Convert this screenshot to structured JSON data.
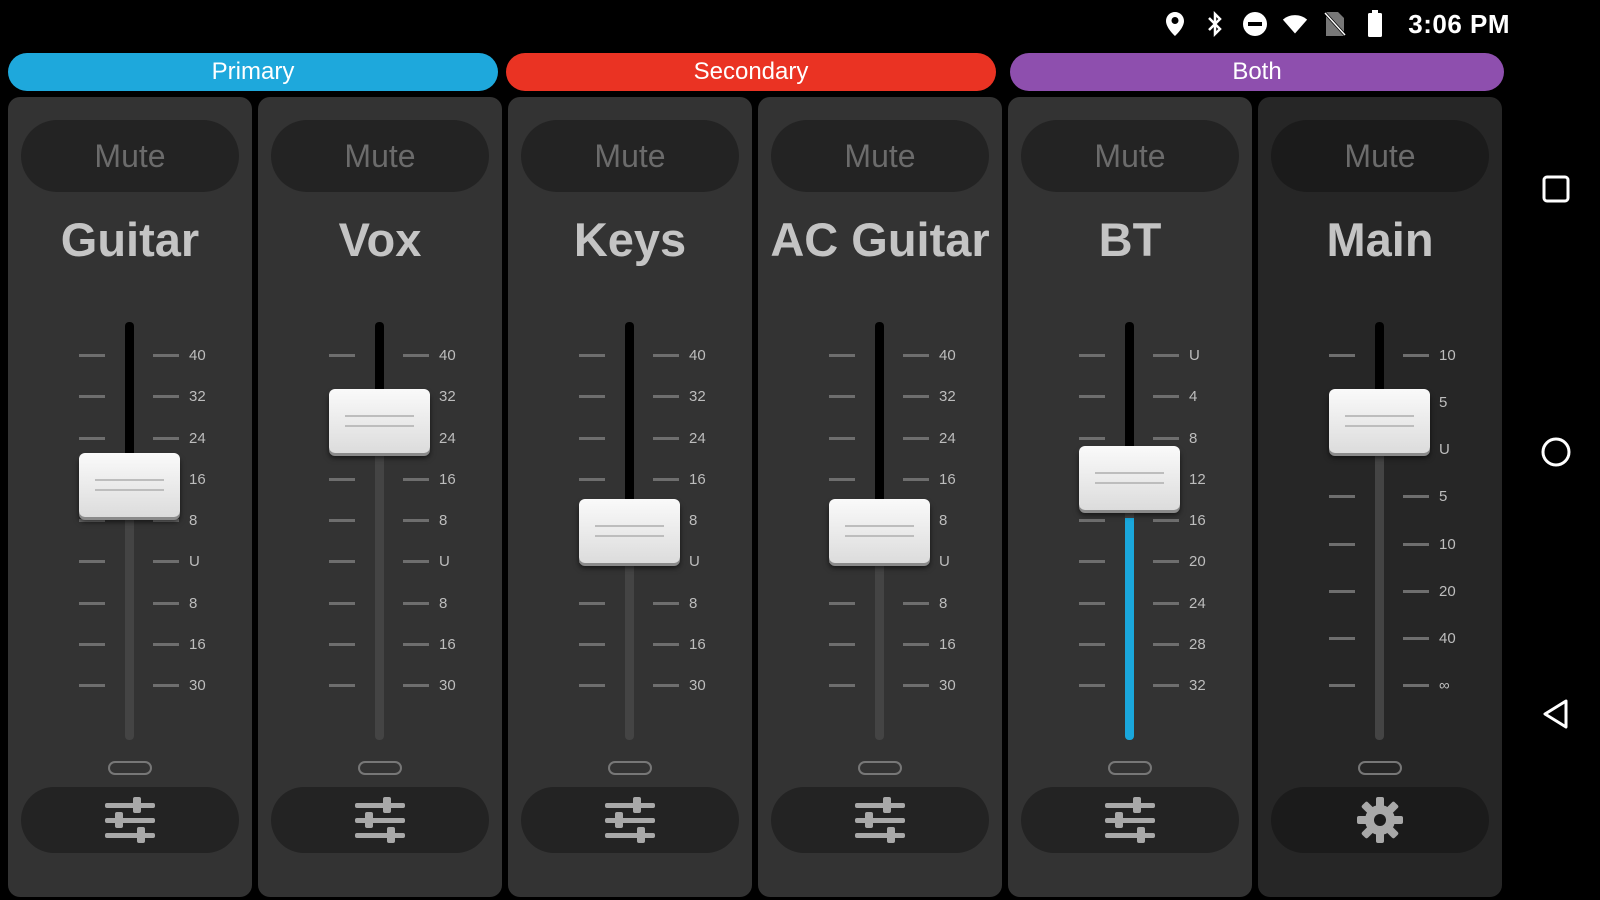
{
  "status_bar": {
    "time": "3:06 PM",
    "icons": [
      "location-icon",
      "bluetooth-icon",
      "do-not-disturb-icon",
      "wifi-icon",
      "no-sim-icon",
      "battery-icon"
    ]
  },
  "groups": [
    {
      "label": "Primary",
      "color": "#1ea8dc"
    },
    {
      "label": "Secondary",
      "color": "#ea3323"
    },
    {
      "label": "Both",
      "color": "#8e4fae"
    }
  ],
  "channels": [
    {
      "name": "Guitar",
      "mute_label": "Mute",
      "scale": [
        "40",
        "32",
        "24",
        "16",
        "8",
        "U",
        "8",
        "16",
        "30"
      ],
      "level": 0.63,
      "meter": 0.0,
      "settings_icon": "sliders-icon"
    },
    {
      "name": "Vox",
      "mute_label": "Mute",
      "scale": [
        "40",
        "32",
        "24",
        "16",
        "8",
        "U",
        "8",
        "16",
        "30"
      ],
      "level": 0.81,
      "meter": 0.0,
      "settings_icon": "sliders-icon"
    },
    {
      "name": "Keys",
      "mute_label": "Mute",
      "scale": [
        "40",
        "32",
        "24",
        "16",
        "8",
        "U",
        "8",
        "16",
        "30"
      ],
      "level": 0.5,
      "meter": 0.0,
      "settings_icon": "sliders-icon"
    },
    {
      "name": "AC Guitar",
      "mute_label": "Mute",
      "scale": [
        "40",
        "32",
        "24",
        "16",
        "8",
        "U",
        "8",
        "16",
        "30"
      ],
      "level": 0.5,
      "meter": 0.0,
      "settings_icon": "sliders-icon"
    },
    {
      "name": "BT",
      "mute_label": "Mute",
      "scale": [
        "U",
        "4",
        "8",
        "12",
        "16",
        "20",
        "24",
        "28",
        "32"
      ],
      "level": 0.65,
      "meter": 0.53,
      "settings_icon": "sliders-icon"
    },
    {
      "name": "Main",
      "mute_label": "Mute",
      "scale": [
        "10",
        "5",
        "U",
        "5",
        "10",
        "20",
        "40",
        "∞"
      ],
      "level": 0.81,
      "meter": 0.0,
      "settings_icon": "gear-icon"
    }
  ],
  "nav": [
    "recents-square-icon",
    "home-circle-icon",
    "back-triangle-icon"
  ]
}
